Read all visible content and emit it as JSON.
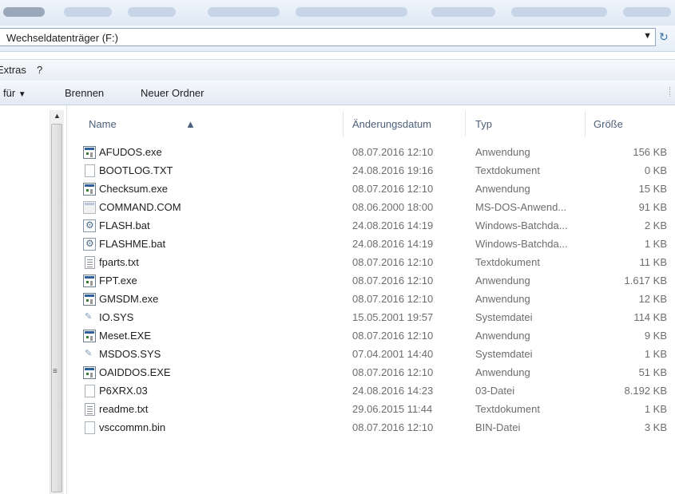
{
  "address": {
    "path": "Wechseldatenträger (F:)"
  },
  "menu": {
    "items": [
      "Extras",
      "?"
    ]
  },
  "commands": {
    "organize": "für",
    "burn": "Brennen",
    "new_folder": "Neuer Ordner"
  },
  "columns": {
    "name": "Name",
    "date": "Änderungsdatum",
    "type": "Typ",
    "size": "Größe"
  },
  "files": [
    {
      "name": "AFUDOS.exe",
      "date": "08.07.2016 12:10",
      "type": "Anwendung",
      "size": "156 KB",
      "icon": "application-icon"
    },
    {
      "name": "BOOTLOG.TXT",
      "date": "24.08.2016 19:16",
      "type": "Textdokument",
      "size": "0 KB",
      "icon": "blank-document-icon"
    },
    {
      "name": "Checksum.exe",
      "date": "08.07.2016 12:10",
      "type": "Anwendung",
      "size": "15 KB",
      "icon": "application-icon"
    },
    {
      "name": "COMMAND.COM",
      "date": "08.06.2000 18:00",
      "type": "MS-DOS-Anwend...",
      "size": "91 KB",
      "icon": "dos-application-icon"
    },
    {
      "name": "FLASH.bat",
      "date": "24.08.2016 14:19",
      "type": "Windows-Batchda...",
      "size": "2 KB",
      "icon": "batch-file-icon"
    },
    {
      "name": "FLASHME.bat",
      "date": "24.08.2016 14:19",
      "type": "Windows-Batchda...",
      "size": "1 KB",
      "icon": "batch-file-icon"
    },
    {
      "name": "fparts.txt",
      "date": "08.07.2016 12:10",
      "type": "Textdokument",
      "size": "11 KB",
      "icon": "text-document-icon"
    },
    {
      "name": "FPT.exe",
      "date": "08.07.2016 12:10",
      "type": "Anwendung",
      "size": "1.617 KB",
      "icon": "application-icon"
    },
    {
      "name": "GMSDM.exe",
      "date": "08.07.2016 12:10",
      "type": "Anwendung",
      "size": "12 KB",
      "icon": "application-icon"
    },
    {
      "name": "IO.SYS",
      "date": "15.05.2001 19:57",
      "type": "Systemdatei",
      "size": "114 KB",
      "icon": "system-file-icon"
    },
    {
      "name": "Meset.EXE",
      "date": "08.07.2016 12:10",
      "type": "Anwendung",
      "size": "9 KB",
      "icon": "application-icon"
    },
    {
      "name": "MSDOS.SYS",
      "date": "07.04.2001 14:40",
      "type": "Systemdatei",
      "size": "1 KB",
      "icon": "system-file-icon"
    },
    {
      "name": "OAIDDOS.EXE",
      "date": "08.07.2016 12:10",
      "type": "Anwendung",
      "size": "51 KB",
      "icon": "application-icon"
    },
    {
      "name": "P6XRX.03",
      "date": "24.08.2016 14:23",
      "type": "03-Datei",
      "size": "8.192 KB",
      "icon": "blank-document-icon"
    },
    {
      "name": "readme.txt",
      "date": "29.06.2015 11:44",
      "type": "Textdokument",
      "size": "1 KB",
      "icon": "text-document-icon"
    },
    {
      "name": "vsccommn.bin",
      "date": "08.07.2016 12:10",
      "type": "BIN-Datei",
      "size": "3 KB",
      "icon": "blank-document-icon"
    }
  ],
  "colors": {
    "header_text": "#4c607a",
    "detail_text": "#6d6d6d",
    "toolbar_top": "#f5f8fc",
    "toolbar_bottom": "#e3eaf3"
  }
}
